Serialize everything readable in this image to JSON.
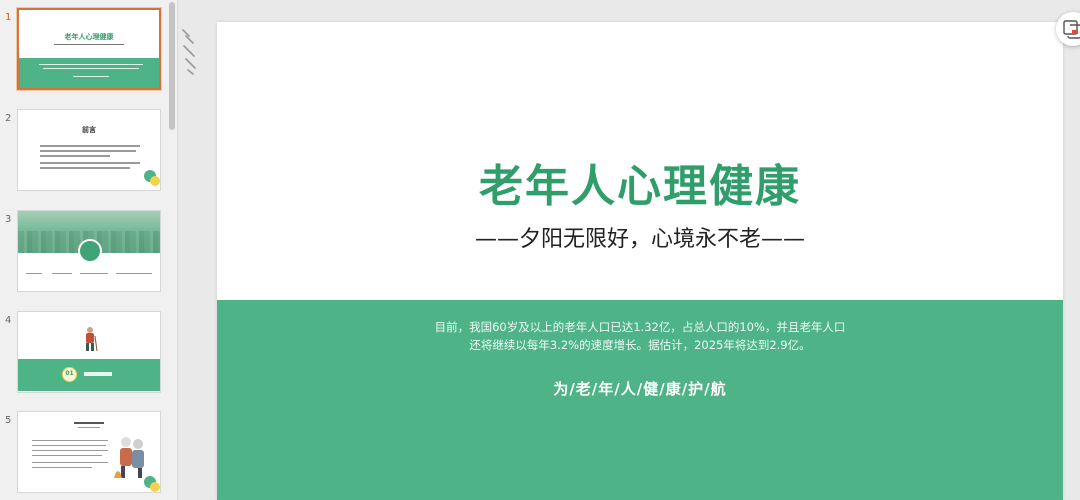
{
  "thumbnails": {
    "items": [
      {
        "number": "1",
        "title": "老年人心理健康"
      },
      {
        "number": "2",
        "title": "前言"
      },
      {
        "number": "3"
      },
      {
        "number": "4",
        "badge": "01"
      },
      {
        "number": "5"
      }
    ]
  },
  "slide": {
    "title": "老年人心理健康",
    "subtitle": "——夕阳无限好，心境永不老——",
    "band_line1": "目前，我国60岁及以上的老年人口已达1.32亿，占总人口的10%，并且老年人口",
    "band_line2": "还将继续以每年3.2%的速度增长。据估计，2025年将达到2.9亿。",
    "slogan": "为/老/年/人/健/康/护/航"
  },
  "colors": {
    "accent_green": "#4fb388",
    "title_green": "#2f9e6b",
    "active_border": "#d1743a"
  },
  "icons": {
    "toolbar": "pen-icon",
    "float": "screen-capture-icon"
  }
}
